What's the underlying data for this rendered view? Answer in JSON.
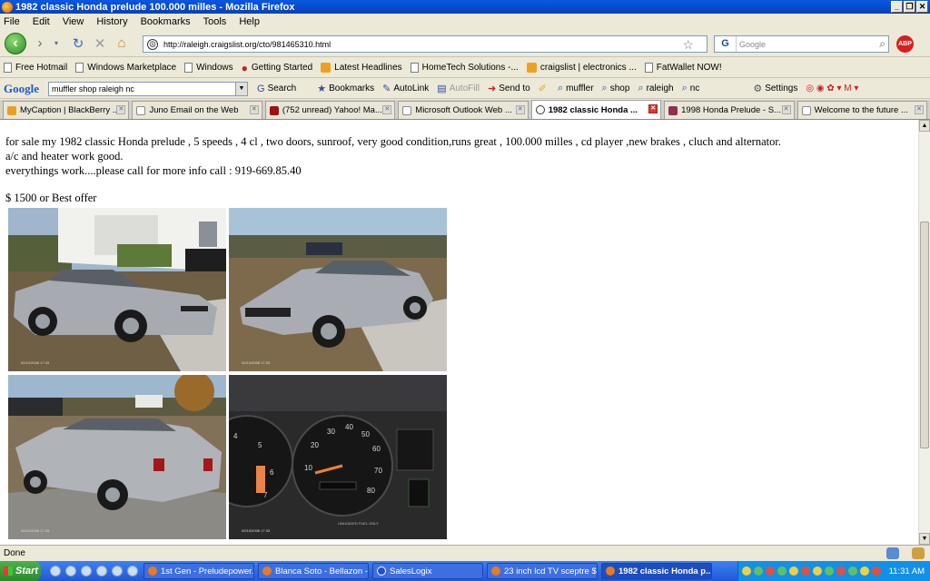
{
  "window": {
    "title": "1982 classic Honda prelude 100.000 milles - Mozilla Firefox"
  },
  "menu": [
    "File",
    "Edit",
    "View",
    "History",
    "Bookmarks",
    "Tools",
    "Help"
  ],
  "nav": {
    "url": "http://raleigh.craigslist.org/cto/981465310.html",
    "search_placeholder": "Google",
    "search_engine": "G",
    "abp": "ABP"
  },
  "bookmarks": [
    {
      "label": "Free Hotmail",
      "icon": "page"
    },
    {
      "label": "Windows Marketplace",
      "icon": "page"
    },
    {
      "label": "Windows",
      "icon": "page"
    },
    {
      "label": "Getting Started",
      "icon": "firefox"
    },
    {
      "label": "Latest Headlines",
      "icon": "rss"
    },
    {
      "label": "HomeTech Solutions -...",
      "icon": "page"
    },
    {
      "label": "craigslist | electronics ...",
      "icon": "rss"
    },
    {
      "label": "FatWallet NOW!",
      "icon": "page"
    }
  ],
  "google_toolbar": {
    "logo": "Google",
    "query": "muffler shop raleigh nc",
    "items": [
      "Search",
      "Bookmarks",
      "AutoLink",
      "AutoFill",
      "Send to",
      "muffler",
      "shop",
      "raleigh",
      "nc",
      "Settings"
    ]
  },
  "tabs": [
    {
      "label": "MyCaption | BlackBerry ...",
      "active": false
    },
    {
      "label": "Juno Email on the Web",
      "active": false
    },
    {
      "label": "(752 unread) Yahoo! Ma...",
      "active": false
    },
    {
      "label": "Microsoft Outlook Web ...",
      "active": false
    },
    {
      "label": "1982 classic Honda ...",
      "active": true
    },
    {
      "label": "1998 Honda Prelude - S...",
      "active": false
    },
    {
      "label": "Welcome to the future ...",
      "active": false
    }
  ],
  "post": {
    "line1": "for sale my 1982 classic Honda prelude , 5 speeds , 4 cl , two doors, sunroof, very good condition,runs great , 100.000 milles , cd player ,new brakes , cluch and alternator.",
    "line2": "a/c and heater work good.",
    "line3": "everythings work....please call for more info call : 919-669.85.40",
    "price": "$ 1500 or Best offer"
  },
  "photos": [
    {
      "name": "photo-front-side",
      "date": "02/10/2008 17:33"
    },
    {
      "name": "photo-front-angle",
      "date": "02/10/2008 17:33"
    },
    {
      "name": "photo-rear-side",
      "date": "02/10/2008 17:33"
    },
    {
      "name": "photo-dashboard",
      "date": "02/10/2008 17:33"
    }
  ],
  "status": {
    "text": "Done"
  },
  "taskbar": {
    "start": "Start",
    "tasks": [
      {
        "label": "1st Gen - Preludepower...",
        "active": false
      },
      {
        "label": "Blanca Soto - Bellazon -...",
        "active": false
      },
      {
        "label": "SalesLogix",
        "active": false
      },
      {
        "label": "23 inch lcd TV sceptre $...",
        "active": false
      },
      {
        "label": "1982 classic Honda p...",
        "active": true
      }
    ],
    "clock": "11:31 AM"
  }
}
